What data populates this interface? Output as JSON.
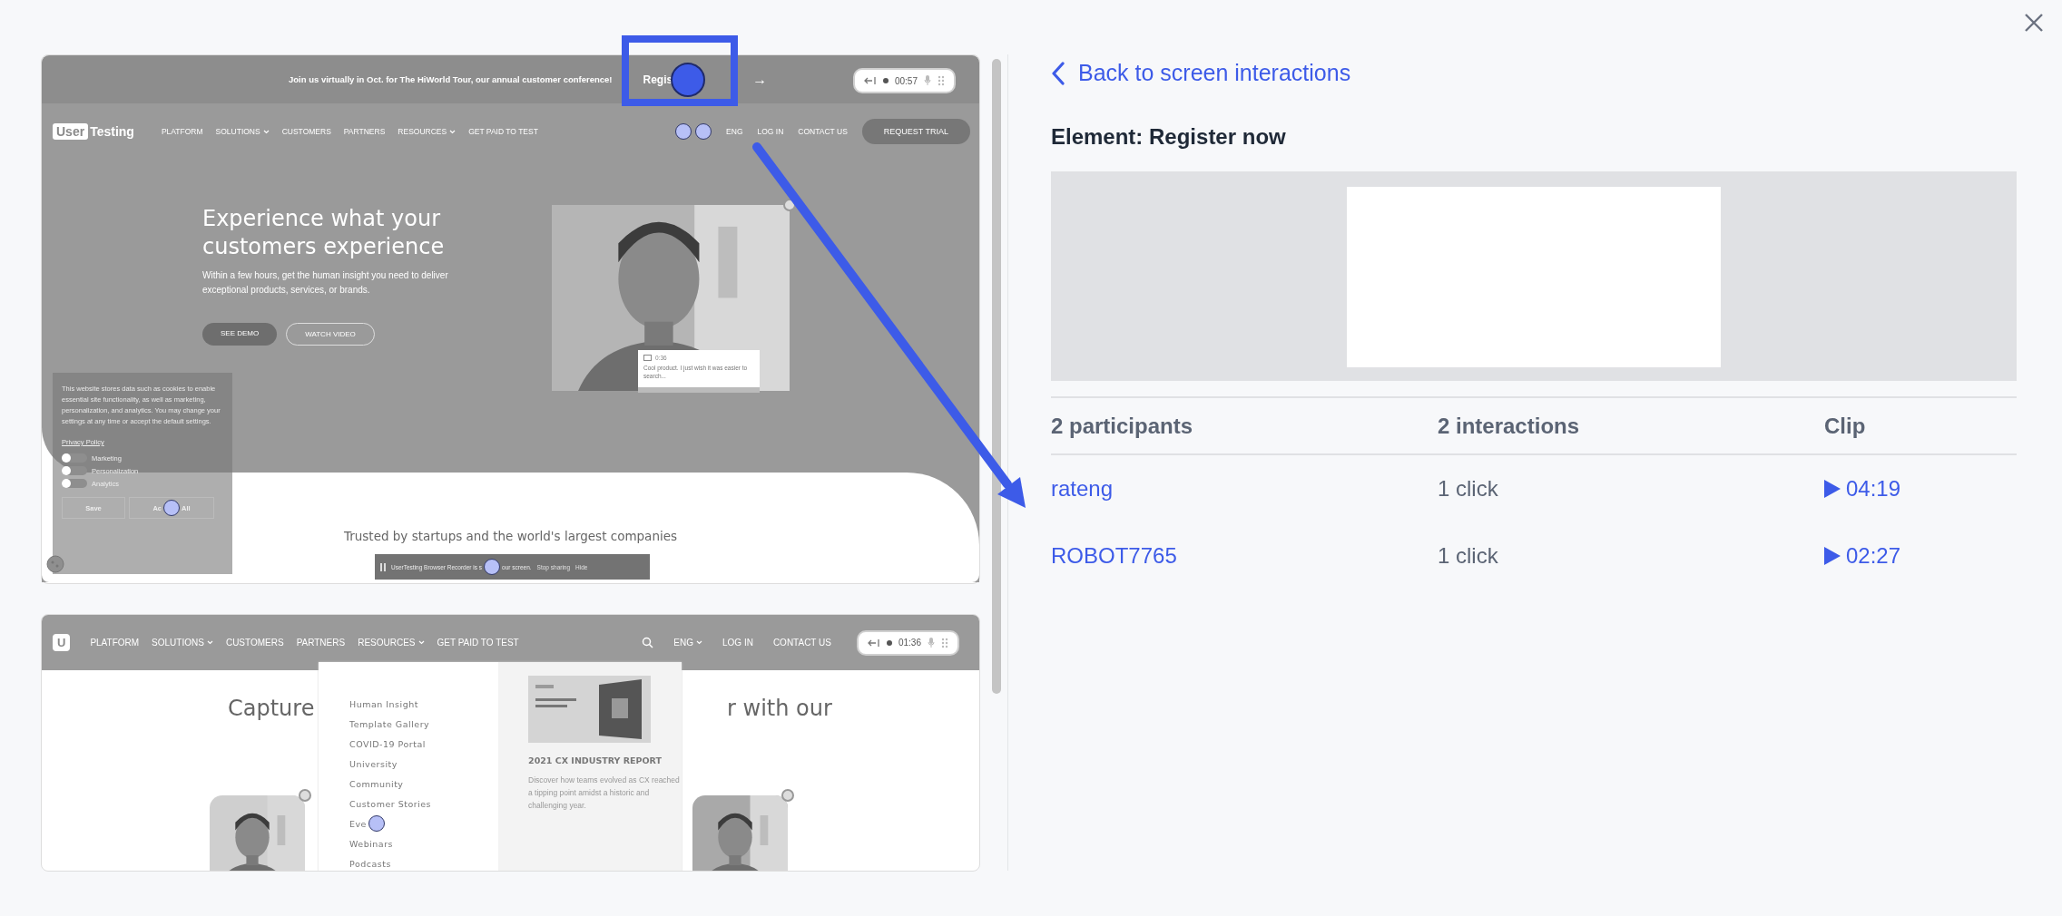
{
  "back_link": "Back to screen interactions",
  "element_title": "Element: Register now",
  "participants_table": {
    "columns": [
      "2 participants",
      "2 interactions",
      "Clip"
    ],
    "rows": [
      {
        "participant": "rateng",
        "interactions": "1 click",
        "clip": "04:19"
      },
      {
        "participant": "ROBOT7765",
        "interactions": "1 click",
        "clip": "02:27"
      }
    ]
  },
  "screenshot_1": {
    "banner": {
      "text": "Join us virtually in Oct. for The HiWorld Tour, our annual customer conference!",
      "link": "Regis",
      "arrow": "→"
    },
    "recorder": {
      "time": "00:57"
    },
    "nav": {
      "logo": [
        "User",
        "Testing"
      ],
      "items": [
        {
          "label": "PLATFORM",
          "dropdown": false
        },
        {
          "label": "SOLUTIONS",
          "dropdown": true
        },
        {
          "label": "CUSTOMERS",
          "dropdown": false
        },
        {
          "label": "PARTNERS",
          "dropdown": false
        },
        {
          "label": "RESOURCES",
          "dropdown": true
        },
        {
          "label": "GET PAID TO TEST",
          "dropdown": false
        }
      ],
      "language": "ENG",
      "login": "LOG IN",
      "contact": "CONTACT US",
      "cta": "REQUEST TRIAL"
    },
    "hero": {
      "title_lines": [
        "Experience what your",
        "customers experience"
      ],
      "subtitle": "Within a few hours, get the human insight you need to deliver exceptional products, services, or brands.",
      "buttons": [
        "SEE DEMO",
        "WATCH VIDEO"
      ]
    },
    "comment": {
      "time": "0:36",
      "text": "Cool product. I just wish it was easier to search..."
    },
    "cookie_notice": {
      "text": "This website stores data such as cookies to enable essential site functionality, as well as marketing, personalization, and analytics. You may change your settings at any time or accept the default settings.",
      "link": "Privacy Policy",
      "toggles": [
        {
          "label": "Marketing",
          "on": false
        },
        {
          "label": "Personalization",
          "on": false
        },
        {
          "label": "Analytics",
          "on": false
        }
      ],
      "buttons": [
        {
          "parts": [
            "Save"
          ]
        },
        {
          "parts": [
            "Ac",
            "All"
          ]
        }
      ]
    },
    "trusted": "Trusted by startups and the world's largest companies",
    "share_bar": {
      "parts": [
        "UserTesting Browser Recorder is s",
        "our screen."
      ],
      "stop": "Stop sharing",
      "hide": "Hide"
    }
  },
  "screenshot_2": {
    "nav": {
      "logo": "U",
      "items": [
        {
          "label": "PLATFORM",
          "dropdown": false
        },
        {
          "label": "SOLUTIONS",
          "dropdown": true
        },
        {
          "label": "CUSTOMERS",
          "dropdown": false
        },
        {
          "label": "PARTNERS",
          "dropdown": false
        },
        {
          "label": "RESOURCES",
          "dropdown": true
        },
        {
          "label": "GET PAID TO TEST",
          "dropdown": false
        }
      ],
      "language": "ENG",
      "login": "LOG IN",
      "contact": "CONTACT US"
    },
    "recorder": {
      "time": "01:36"
    },
    "heading_parts": [
      "Capture",
      "r with our"
    ],
    "menu": {
      "items": [
        {
          "label": "Human Insight",
          "clicked": false
        },
        {
          "label": "Template Gallery",
          "clicked": false
        },
        {
          "label": "COVID-19 Portal",
          "clicked": false
        },
        {
          "label": "University",
          "clicked": false
        },
        {
          "label": "Community",
          "clicked": false
        },
        {
          "label": "Customer Stories",
          "clicked": false
        },
        {
          "label": "Eve",
          "clicked": true
        },
        {
          "label": "Webinars",
          "clicked": false
        },
        {
          "label": "Podcasts",
          "clicked": false
        }
      ],
      "report": {
        "title": "2021 CX INDUSTRY REPORT",
        "text": "Discover how teams evolved as CX reached a tipping point amidst a historic and challenging year."
      }
    }
  }
}
